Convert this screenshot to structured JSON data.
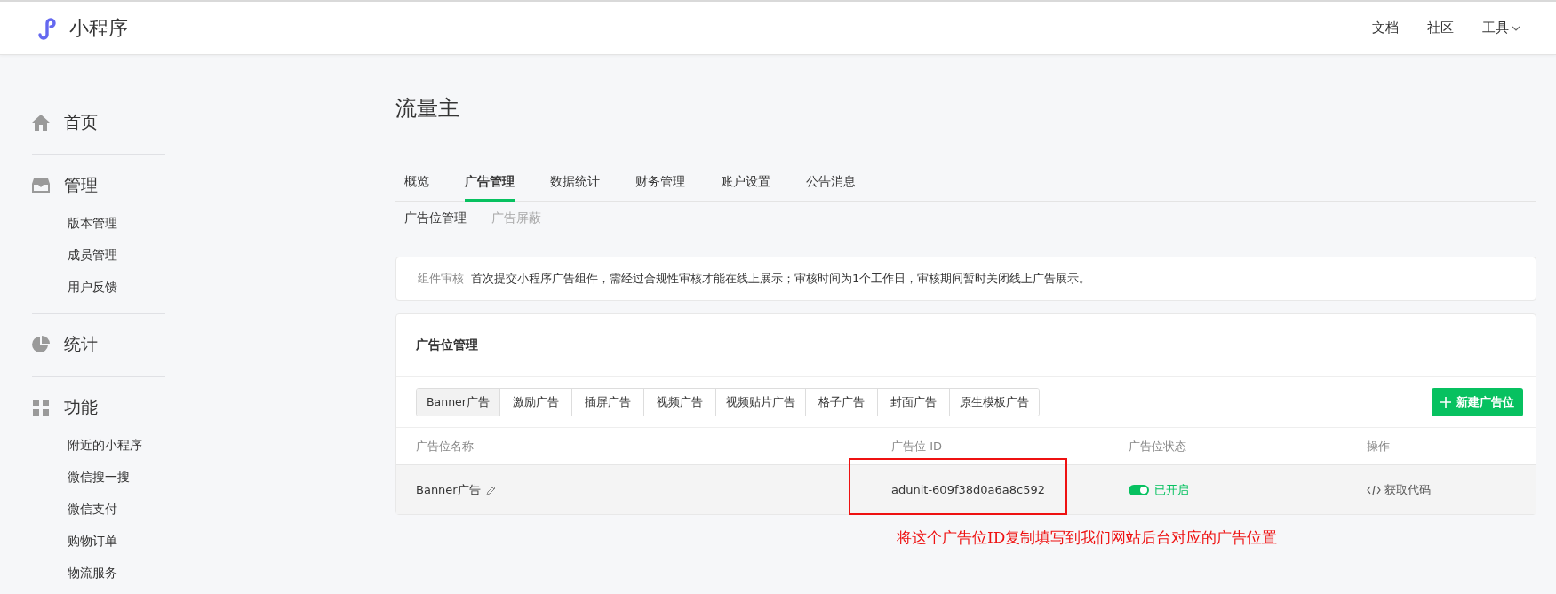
{
  "header": {
    "logo_text": "小程序",
    "links": [
      {
        "label": "文档",
        "dropdown": false
      },
      {
        "label": "社区",
        "dropdown": false
      },
      {
        "label": "工具",
        "dropdown": true
      }
    ]
  },
  "sidebar": {
    "sections": [
      {
        "kind": "home",
        "label": "首页"
      },
      {
        "kind": "inbox",
        "label": "管理",
        "items": [
          "版本管理",
          "成员管理",
          "用户反馈"
        ]
      },
      {
        "kind": "pie",
        "label": "统计"
      },
      {
        "kind": "grid",
        "label": "功能",
        "items": [
          "附近的小程序",
          "微信搜一搜",
          "微信支付",
          "购物订单",
          "物流服务"
        ]
      }
    ]
  },
  "page_title": "流量主",
  "tabs": [
    {
      "label": "概览",
      "selected": false
    },
    {
      "label": "广告管理",
      "selected": true
    },
    {
      "label": "数据统计",
      "selected": false
    },
    {
      "label": "财务管理",
      "selected": false
    },
    {
      "label": "账户设置",
      "selected": false
    },
    {
      "label": "公告消息",
      "selected": false
    }
  ],
  "subtabs": [
    {
      "label": "广告位管理",
      "selected": true
    },
    {
      "label": "广告屏蔽",
      "selected": false
    }
  ],
  "notice": {
    "label": "组件审核",
    "text": "首次提交小程序广告组件，需经过合规性审核才能在线上展示；审核时间为1个工作日，审核期间暂时关闭线上广告展示。"
  },
  "panel": {
    "title": "广告位管理",
    "ad_types": [
      {
        "label": "Banner广告",
        "selected": true
      },
      {
        "label": "激励广告",
        "selected": false
      },
      {
        "label": "插屏广告",
        "selected": false
      },
      {
        "label": "视频广告",
        "selected": false
      },
      {
        "label": "视频贴片广告",
        "selected": false
      },
      {
        "label": "格子广告",
        "selected": false
      },
      {
        "label": "封面广告",
        "selected": false
      },
      {
        "label": "原生模板广告",
        "selected": false
      }
    ],
    "new_button": "新建广告位",
    "table": {
      "columns": [
        "广告位名称",
        "广告位 ID",
        "广告位状态",
        "操作"
      ],
      "rows": [
        {
          "name": "Banner广告",
          "id": "adunit-609f38d0a6a8c592",
          "status": {
            "on": true,
            "label": "已开启"
          },
          "action": "获取代码"
        }
      ]
    }
  },
  "annotation": {
    "text": "将这个广告位ID复制填写到我们网站后台对应的广告位置"
  }
}
